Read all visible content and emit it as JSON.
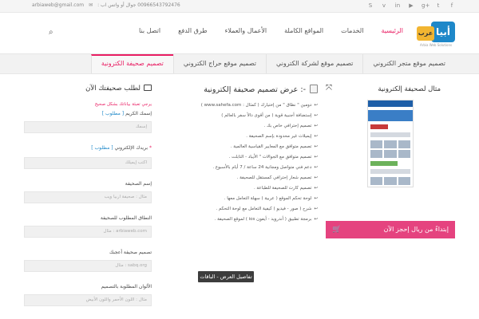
{
  "topbar": {
    "email": "arbiaweb@gmail.com",
    "phone": "00966543792476 جوال أو واتس اب :",
    "social_icons": [
      "skype-icon",
      "vimeo-icon",
      "linkedin-icon",
      "youtube-icon",
      "google-plus-icon",
      "twitter-icon",
      "facebook-icon"
    ]
  },
  "logo": {
    "main": "أبيا",
    "secondary": "عرب",
    "sub": "Arbia Web Solutions"
  },
  "nav": {
    "items": [
      "الرئيسية",
      "الخدمات",
      "المواقع الكاملة",
      "الأعمال والعملاء",
      "طرق الدفع",
      "اتصل بنا"
    ]
  },
  "tabs": [
    "تصميم موقع متجر الكتروني",
    "تصميم موقع لشركة الكتروني",
    "تصميم موقع حراج الكتروني",
    "تصميم صحيفة الكترونية"
  ],
  "right": {
    "title": "مثال لصحيفة إلكترونية",
    "cta": "إبتداءً من  ريال  إحجز الآن"
  },
  "middle": {
    "title": "عرض تصميم صحيفة إلكترونية :-",
    "features": [
      "دومين \" نطاق \" من إختيارك ( كمثال : www.sahefa.com )",
      "إستضافة أجنبية قوية ( من أقوى دالأ سفر بالعالم )",
      "تصميم إحترافي خاص بك .",
      "إيميلات غير محدودة بإسم الصحيفة .",
      "تصميم متوافق مع المعايير القياسية العالمية .",
      "تصميم متوافق مع الجوالات \" الأيباد - التابلت .",
      "دعم فني متواصل ومجانية 24 ساعة / 7 أيام بالأسبوع .",
      "تصميم شعار إحترافي كمستقل للصحيفة .",
      "تصميم كارت للصحيفة للطباعة .",
      "لوحة تحكم الموقع ( عربية ) سهلة التعامل معها .",
      "شرح ( صور - فيديو ) كيفية التعامل مع لوحة التحكم .",
      "برمجة تطبيق ( أندرويد - أيفون ios ) لموقع الصحيفة ."
    ],
    "details_button": "تفاصيل العرض - الباقات"
  },
  "form": {
    "title": "لطلب صحيفتك الآن",
    "note": "يرجي تعبئة بياناتك بشكل صحيح",
    "fields": [
      {
        "label": "إسمك الكريم",
        "required_tag": "[ مطلوب ]",
        "placeholder": "إسمك"
      },
      {
        "label": "بريدك الإلكتروني",
        "required_tag": "[ مطلوب ]",
        "placeholder": "اكتب إيميلك"
      },
      {
        "label": "إسم الصحيفة",
        "required_tag": "",
        "placeholder": "مثال : صحيفة اربيا ويب"
      },
      {
        "label": "النطاق المطلوب للصحيفة",
        "required_tag": "",
        "placeholder": "مثال : arbiaweb.com"
      },
      {
        "label": "تصميم صحيفة أعجبك",
        "required_tag": "",
        "placeholder": "مثال : sabq.org"
      },
      {
        "label": "الألوان المطلوبة بالتصميم",
        "required_tag": "",
        "placeholder": "مثال : اللون الأحمر واللون الأبيض"
      }
    ]
  },
  "colors": {
    "accent": "#e91e63",
    "cta": "#e5437f",
    "link": "#1e88c9",
    "dark_button": "#3d3d3d"
  }
}
